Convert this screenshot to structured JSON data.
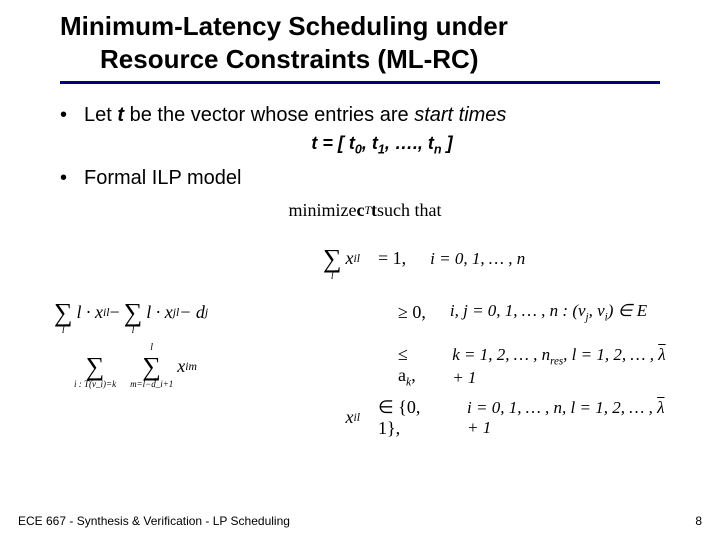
{
  "title": {
    "line1": "Minimum-Latency Scheduling under",
    "line2": "Resource Constraints  (ML-RC)"
  },
  "bullet1": {
    "prefix": "Let ",
    "var": "t",
    "middle": " be the vector whose entries are ",
    "emph": "start times"
  },
  "vector_def": "t = [ t0, t1, …., tn ]",
  "vector_def_parts": {
    "open": "t = [ t",
    "s0": "0",
    "c1": ", t",
    "s1": "1",
    "mid": ", …., t",
    "sn": "n",
    "close": " ]"
  },
  "bullet2": "Formal ILP model",
  "math": {
    "objective": {
      "pre": "minimize ",
      "cT": "c",
      "supT": "T",
      "tvec": "t",
      "post": " such that"
    },
    "row1": {
      "sum_bot": "l",
      "term": "x",
      "term_sub": "il",
      "eq": "=   1,",
      "cond": "i = 0, 1, … , n"
    },
    "row2": {
      "sum1_bot": "l",
      "t1": "l · x",
      "t1_sub": "il",
      "minus": " − ",
      "sum2_bot": "l",
      "t2": "l · x",
      "t2_sub": "jl",
      "t3": " − d",
      "t3_sub": "j",
      "rel": "≥   0,",
      "cond_a": "i, j = 0, 1, … , n : (v",
      "cond_sub1": "j",
      "cond_mid": ", v",
      "cond_sub2": "i",
      "cond_b": ") ∈ E"
    },
    "row3": {
      "sum1_bot": "i : T(v_i)=k",
      "sum2_top": "l",
      "sum2_bot": "m=l−d_i+1",
      "term": "x",
      "term_sub": "im",
      "rel": "≤   a",
      "rel_sub": "k",
      "comma": ",",
      "cond": "k = 1, 2, … , n",
      "cond_sub": "res",
      "cond2a": ",    l = 1, 2, … , ",
      "lambda": "λ",
      "cond2b": " + 1"
    },
    "row4": {
      "term": "x",
      "term_sub": "il",
      "rel": "∈   {0, 1},",
      "cond": "i = 0, 1, … , n,    l = 1, 2, … , ",
      "lambda": "λ",
      "cond2": " + 1"
    }
  },
  "footer": {
    "left": "ECE 667 - Synthesis & Verification - LP Scheduling",
    "right": "8"
  }
}
